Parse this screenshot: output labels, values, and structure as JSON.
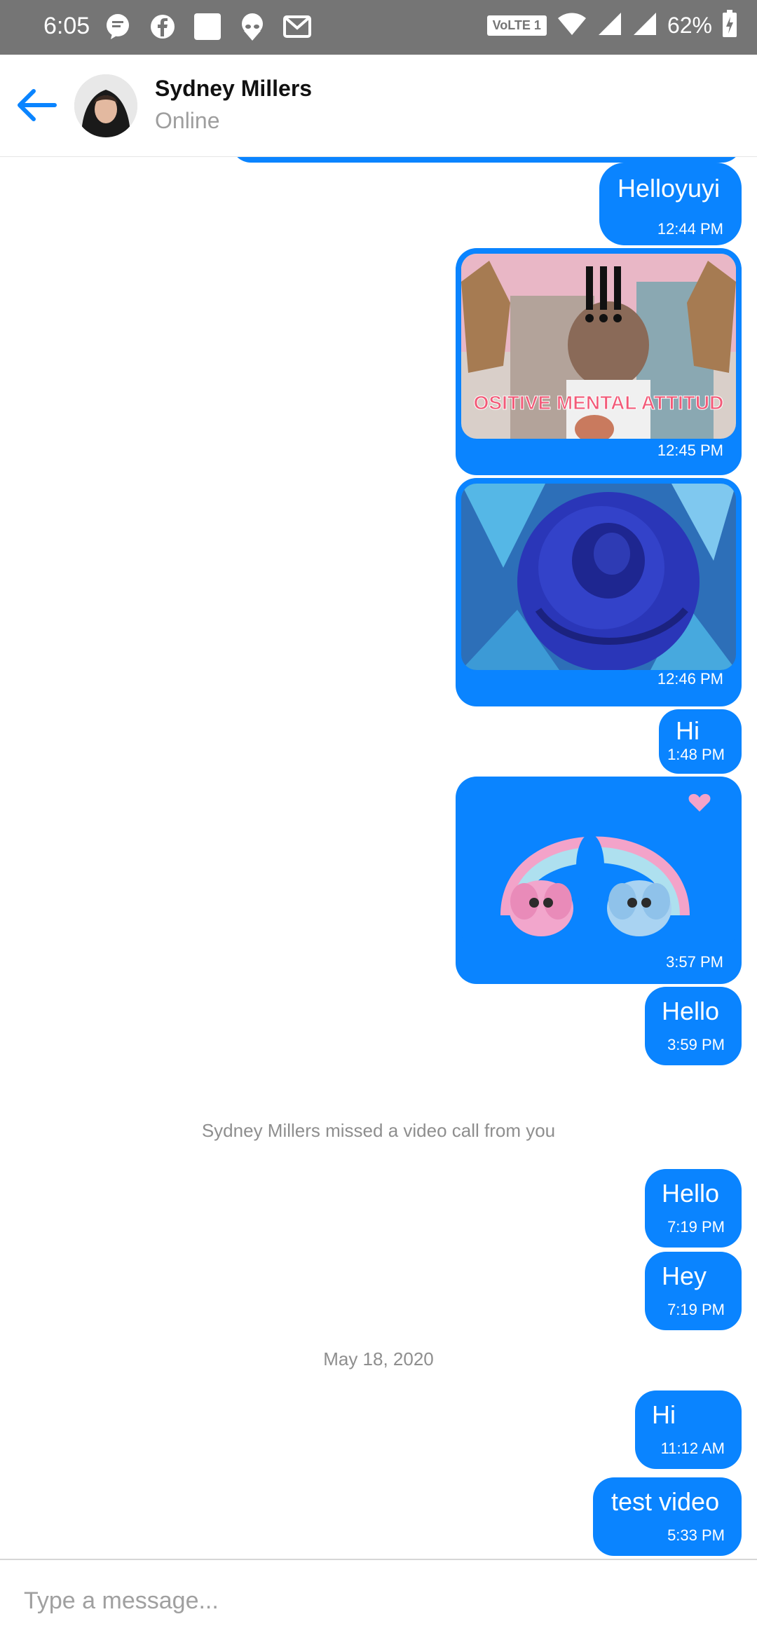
{
  "status_bar": {
    "time": "6:05",
    "network_badge": "VoLTE 1",
    "battery": "62%"
  },
  "header": {
    "contact_name": "Sydney Millers",
    "contact_status": "Online"
  },
  "messages": [
    {
      "type": "text",
      "text": "Helloyuyi",
      "time": "12:44 PM"
    },
    {
      "type": "media",
      "media": "gif-positive-mental-attitude",
      "overlay_text": "OSITIVE MENTAL ATTITUD",
      "time": "12:45 PM"
    },
    {
      "type": "media",
      "media": "gif-blue-rose",
      "time": "12:46 PM"
    },
    {
      "type": "text",
      "text": "Hi",
      "time": "1:48 PM"
    },
    {
      "type": "media",
      "media": "sticker-trolls-rainbow",
      "time": "3:57 PM"
    },
    {
      "type": "text",
      "text": "Hello",
      "time": "3:59 PM"
    },
    {
      "type": "system",
      "text": "Sydney Millers missed a video call from you"
    },
    {
      "type": "text",
      "text": "Hello",
      "time": "7:19 PM"
    },
    {
      "type": "text",
      "text": "Hey",
      "time": "7:19 PM"
    },
    {
      "type": "date",
      "text": "May 18, 2020"
    },
    {
      "type": "text",
      "text": "Hi",
      "time": "11:12 AM"
    },
    {
      "type": "text",
      "text": "test video",
      "time": "5:33 PM"
    }
  ],
  "composer": {
    "placeholder": "Type a message..."
  },
  "colors": {
    "accent": "#0a84ff",
    "status_bar": "#757575"
  }
}
